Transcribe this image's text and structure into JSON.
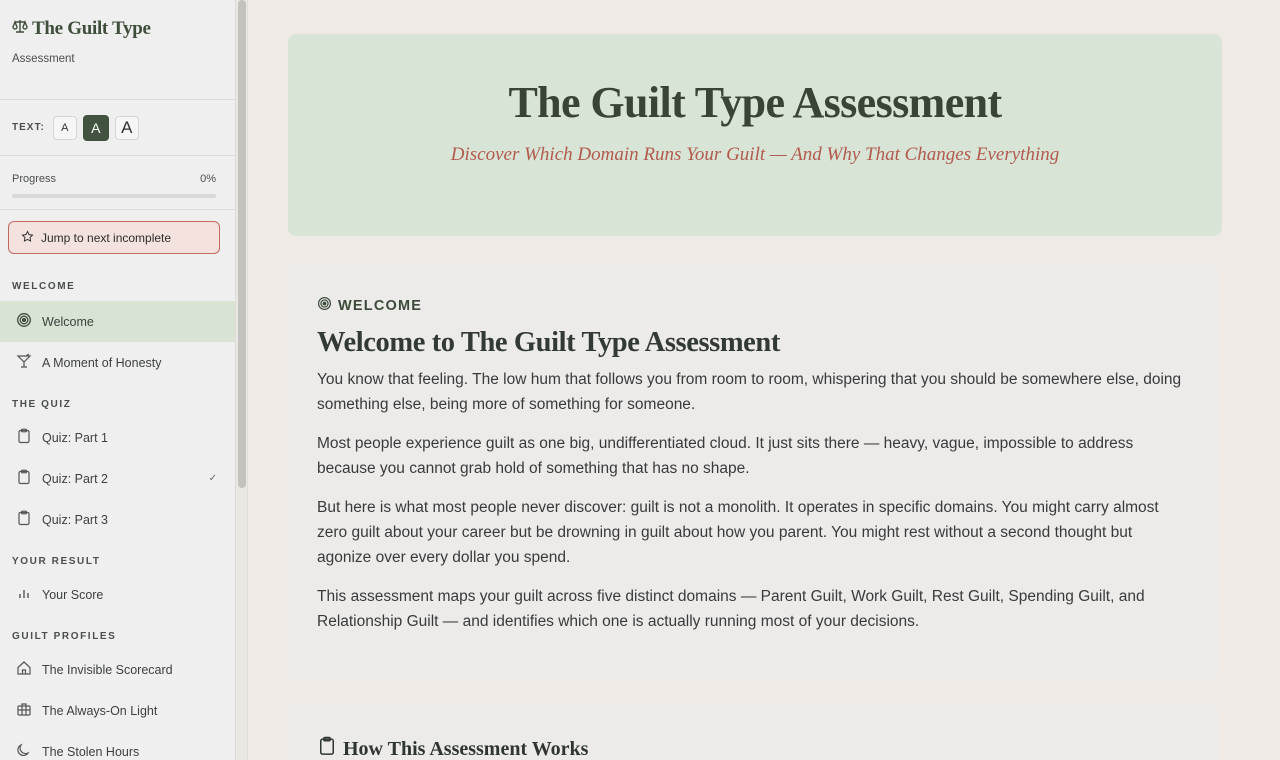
{
  "sidebar": {
    "brand": {
      "title": "The Guilt Type",
      "subtitle": "Assessment"
    },
    "text_size": {
      "label": "TEXT:",
      "small": "A",
      "medium": "A",
      "large": "A"
    },
    "progress": {
      "label": "Progress",
      "value_text": "0%",
      "value": 0
    },
    "jump_label": "Jump to next incomplete",
    "sections": {
      "welcome": {
        "label": "WELCOME",
        "items": [
          {
            "label": "Welcome",
            "icon": "target-icon",
            "active": true
          },
          {
            "label": "A Moment of Honesty",
            "icon": "cocktail-glass-icon"
          }
        ]
      },
      "quiz": {
        "label": "THE QUIZ",
        "items": [
          {
            "label": "Quiz: Part 1",
            "icon": "clipboard-icon"
          },
          {
            "label": "Quiz: Part 2",
            "icon": "clipboard-icon",
            "check": "✓"
          },
          {
            "label": "Quiz: Part 3",
            "icon": "clipboard-icon"
          }
        ]
      },
      "result": {
        "label": "YOUR RESULT",
        "items": [
          {
            "label": "Your Score",
            "icon": "bar-chart-icon"
          }
        ]
      },
      "profiles": {
        "label": "GUILT PROFILES",
        "items": [
          {
            "label": "The Invisible Scorecard",
            "icon": "home-icon"
          },
          {
            "label": "The Always-On Light",
            "icon": "briefcase-icon"
          },
          {
            "label": "The Stolen Hours",
            "icon": "moon-icon"
          }
        ]
      }
    }
  },
  "hero": {
    "title": "The Guilt Type Assessment",
    "subtitle": "Discover Which Domain Runs Your Guilt — And Why That Changes Everything"
  },
  "welcome_card": {
    "kicker": "WELCOME",
    "heading": "Welcome to The Guilt Type Assessment",
    "paragraphs": [
      "You know that feeling. The low hum that follows you from room to room, whispering that you should be somewhere else, doing something else, being more of something for someone.",
      "Most people experience guilt as one big, undifferentiated cloud. It just sits there — heavy, vague, impossible to address because you cannot grab hold of something that has no shape.",
      "But here is what most people never discover: guilt is not a monolith. It operates in specific domains. You might carry almost zero guilt about your career but be drowning in guilt about how you parent. You might rest without a second thought but agonize over every dollar you spend.",
      "This assessment maps your guilt across five distinct domains — Parent Guilt, Work Guilt, Rest Guilt, Spending Guilt, and Relationship Guilt — and identifies which one is actually running most of your decisions."
    ]
  },
  "how_card": {
    "heading": "How This Assessment Works"
  },
  "colors": {
    "accent": "#42543f",
    "hero_bg": "#d7e4d6",
    "subtitle": "#b25a4d",
    "jump_border": "#c26a5d"
  }
}
